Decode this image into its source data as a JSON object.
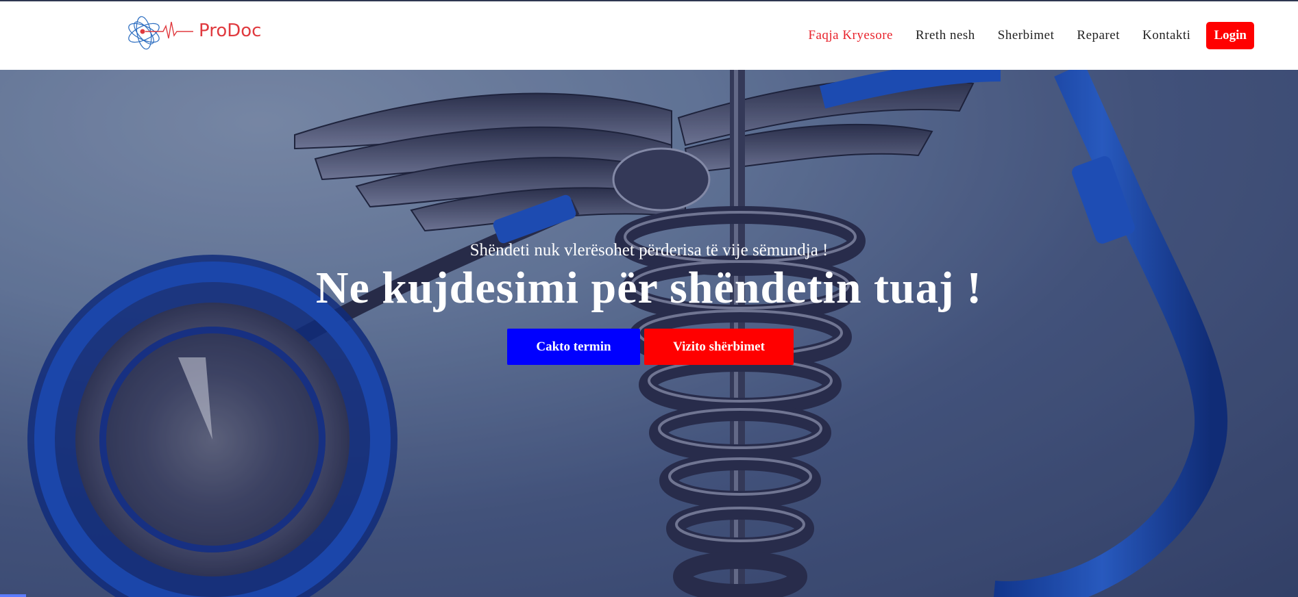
{
  "header": {
    "brand": "ProDoc",
    "nav": [
      {
        "label": "Faqja Kryesore",
        "active": true
      },
      {
        "label": "Rreth nesh",
        "active": false
      },
      {
        "label": "Sherbimet",
        "active": false
      },
      {
        "label": "Reparet",
        "active": false
      },
      {
        "label": "Kontakti",
        "active": false
      }
    ],
    "login_label": "Login"
  },
  "hero": {
    "subtitle": "Shëndeti nuk vlerësohet përderisa të vije sëmundja !",
    "title": "Ne kujdesimi për shëndetin tuaj !",
    "primary_button": "Cakto termin",
    "secondary_button": "Vizito shërbimet"
  },
  "colors": {
    "brand_red": "#e03a3f",
    "active_nav": "#e8222b",
    "login_bg": "#ff0000",
    "primary_cta": "#0000ff",
    "secondary_cta": "#ff0000"
  },
  "icons": {
    "logo": "atom-heartbeat-logo-icon"
  }
}
